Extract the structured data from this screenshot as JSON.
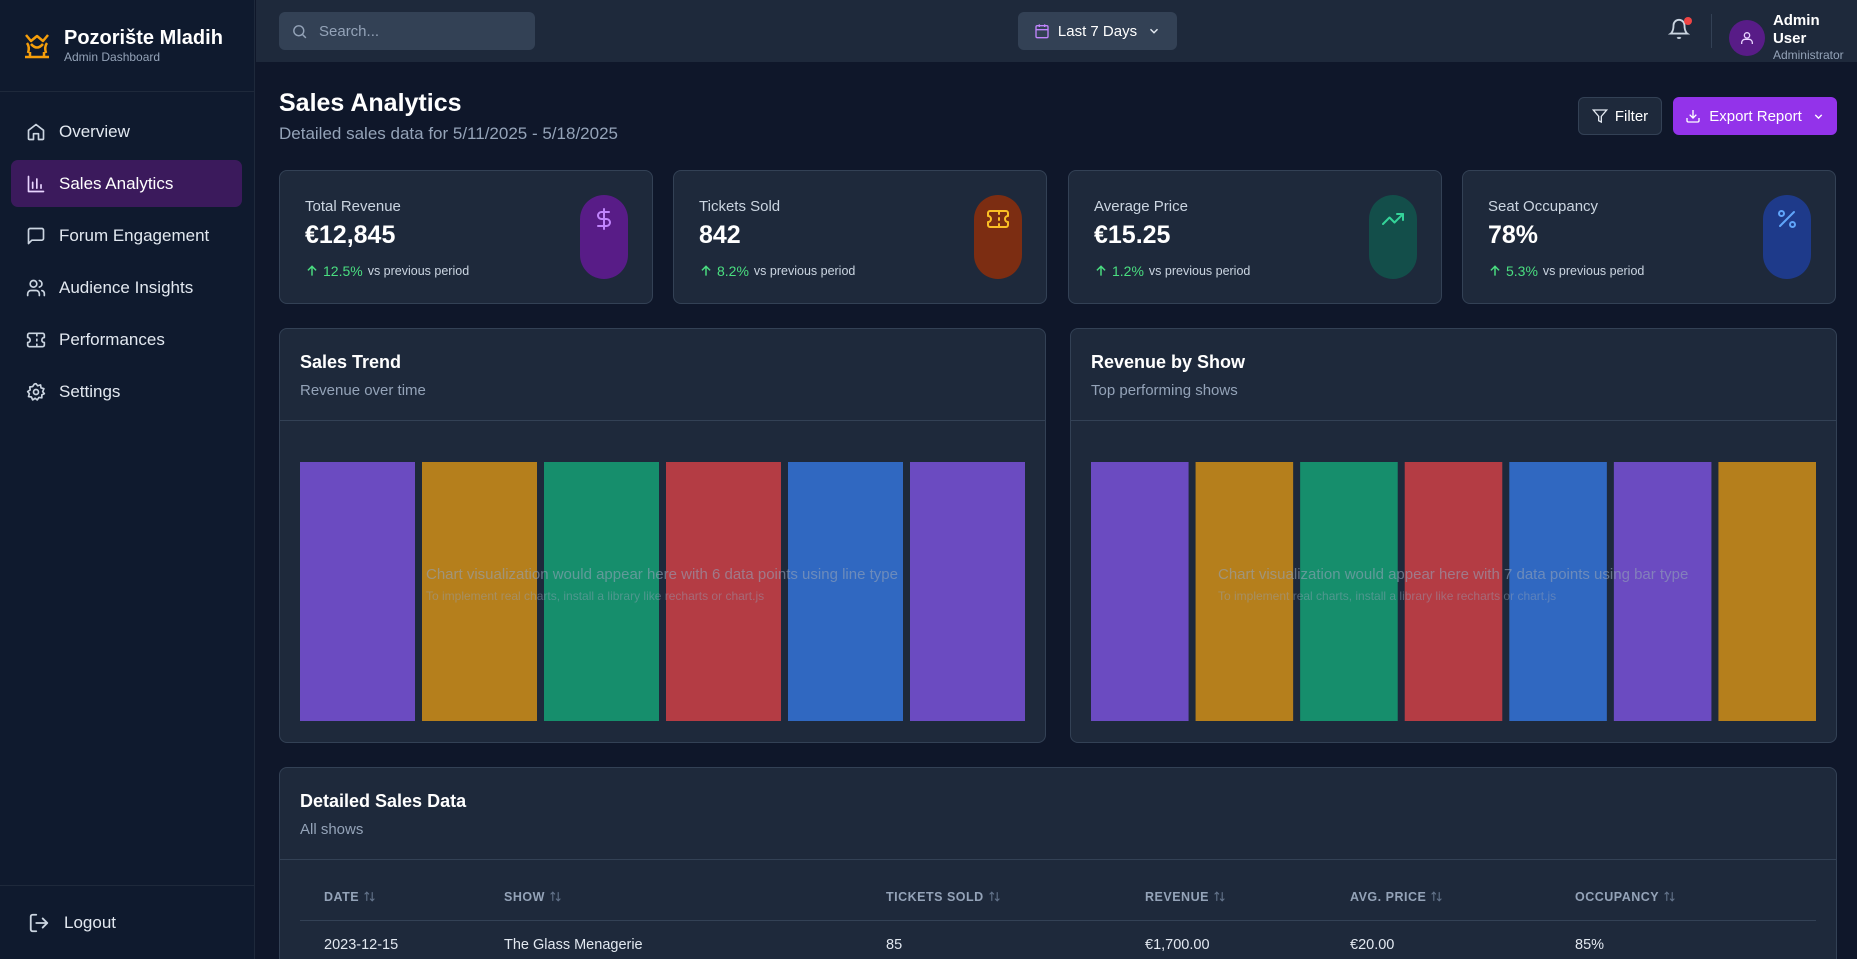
{
  "brand": {
    "title": "Pozorište Mladih",
    "subtitle": "Admin Dashboard"
  },
  "sidebar": {
    "items": [
      {
        "label": "Overview",
        "icon": "home-icon",
        "active": false
      },
      {
        "label": "Sales Analytics",
        "icon": "bar-chart-icon",
        "active": true
      },
      {
        "label": "Forum Engagement",
        "icon": "message-square-icon",
        "active": false
      },
      {
        "label": "Audience Insights",
        "icon": "users-icon",
        "active": false
      },
      {
        "label": "Performances",
        "icon": "ticket-icon",
        "active": false
      },
      {
        "label": "Settings",
        "icon": "gear-icon",
        "active": false
      }
    ],
    "logout_label": "Logout"
  },
  "header": {
    "search_placeholder": "Search...",
    "date_range_label": "Last 7 Days",
    "user_name": "Admin User",
    "user_role": "Administrator"
  },
  "page": {
    "title": "Sales Analytics",
    "subtitle": "Detailed sales data for 5/11/2025 - 5/18/2025",
    "filter_label": "Filter",
    "export_label": "Export Report"
  },
  "stats": [
    {
      "label": "Total Revenue",
      "value": "€12,845",
      "change": "12.5%",
      "vs": "vs previous period",
      "icon": "dollar-icon",
      "bg": "#581c87",
      "fg": "#c084fc"
    },
    {
      "label": "Tickets Sold",
      "value": "842",
      "change": "8.2%",
      "vs": "vs previous period",
      "icon": "ticket-icon",
      "bg": "#7c2d12",
      "fg": "#fbbf24"
    },
    {
      "label": "Average Price",
      "value": "€15.25",
      "change": "1.2%",
      "vs": "vs previous period",
      "icon": "trending-up-icon",
      "bg": "#134e4a",
      "fg": "#34d399"
    },
    {
      "label": "Seat Occupancy",
      "value": "78%",
      "change": "5.3%",
      "vs": "vs previous period",
      "icon": "percent-icon",
      "bg": "#1e3a8a",
      "fg": "#60a5fa"
    }
  ],
  "charts": {
    "trend": {
      "title": "Sales Trend",
      "subtitle": "Revenue over time",
      "message": "Chart visualization would appear here with 6 data points using line type",
      "hint": "To implement real charts, install a library like recharts or chart.js"
    },
    "by_show": {
      "title": "Revenue by Show",
      "subtitle": "Top performing shows",
      "message": "Chart visualization would appear here with 7 data points using bar type",
      "hint": "To implement real charts, install a library like recharts or chart.js"
    }
  },
  "chart_data": [
    {
      "type": "bar",
      "values": [
        1,
        1,
        1,
        1,
        1,
        1
      ],
      "colors": [
        "#6b4bc1",
        "#b57f1c",
        "#168e6c",
        "#b43c44",
        "#3068c1",
        "#6b4bc1"
      ]
    },
    {
      "type": "bar",
      "values": [
        1,
        1,
        1,
        1,
        1,
        1,
        1
      ],
      "colors": [
        "#6b4bc1",
        "#b57f1c",
        "#168e6c",
        "#b43c44",
        "#3068c1",
        "#6b4bc1",
        "#b57f1c"
      ]
    }
  ],
  "table": {
    "title": "Detailed Sales Data",
    "subtitle": "All shows",
    "columns": [
      "DATE",
      "SHOW",
      "TICKETS SOLD",
      "REVENUE",
      "AVG. PRICE",
      "OCCUPANCY"
    ],
    "rows": [
      [
        "2023-12-15",
        "The Glass Menagerie",
        "85",
        "€1,700.00",
        "€20.00",
        "85%"
      ]
    ]
  }
}
